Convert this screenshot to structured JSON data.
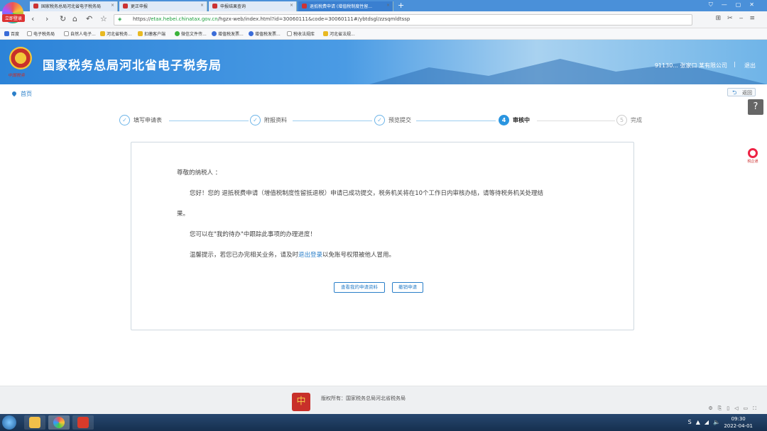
{
  "browser": {
    "badge": "立即登录",
    "tabs": [
      {
        "title": "国家税务总局河北省电子税务局"
      },
      {
        "title": "更正申报"
      },
      {
        "title": "申报结果查询"
      },
      {
        "title": "退抵税费申请 (增值税制度性留..."
      }
    ],
    "new_tab": "+",
    "url_prefix": "https://",
    "url_host": "etax.hebei.chinatax.gov.cn",
    "url_path": "/hgzx-web/index.html?id=30060111&code=30060111#/ybtdsgl/zzsqmldtssp",
    "bookmarks": [
      "百度",
      "电子税务局",
      "自然人电子...",
      "河北省税务...",
      "扣缴客户端",
      "微信文件传...",
      "增值税发票...",
      "增值税发票...",
      "税收法规库",
      "河北省法规..."
    ]
  },
  "header": {
    "emblem_sub": "中国税务",
    "title": "国家税务总局河北省电子税务局",
    "user": "91130... 张家口 某有限公司",
    "separator": "|",
    "logout": "退出"
  },
  "breadcrumb": {
    "home": "首页"
  },
  "back_button": "返回",
  "help": "?",
  "side_logo": "税企通",
  "steps": [
    {
      "num": "✓",
      "label": "填写申请表",
      "state": "done"
    },
    {
      "num": "✓",
      "label": "附报资料",
      "state": "done"
    },
    {
      "num": "✓",
      "label": "预览提交",
      "state": "done"
    },
    {
      "num": "4",
      "label": "审核中",
      "state": "current"
    },
    {
      "num": "5",
      "label": "完成",
      "state": "todo"
    }
  ],
  "message": {
    "greeting": "尊敬的纳税人 ：",
    "line1": "您好！您的 退抵税费申请（增值税制度性留抵退税）申请已成功提交，税务机关将在10个工作日内审核办结，请等待税务机关处理结",
    "line1_cont": "果。",
    "line2": "您可以在\"我的待办\"中跟踪此事项的办理进度！",
    "tip_before": "温馨提示，若您已办完相关业务，请及时",
    "tip_link": "退出登录",
    "tip_after": "以免账号权限被他人冒用。"
  },
  "buttons": {
    "view": "查看我的申请资料",
    "revoke": "撤销申请"
  },
  "footer": {
    "copyright": "版权所有：国家税务总局河北省税务局"
  },
  "taskbar": {
    "time": "09:30",
    "date": "2022-04-01"
  }
}
